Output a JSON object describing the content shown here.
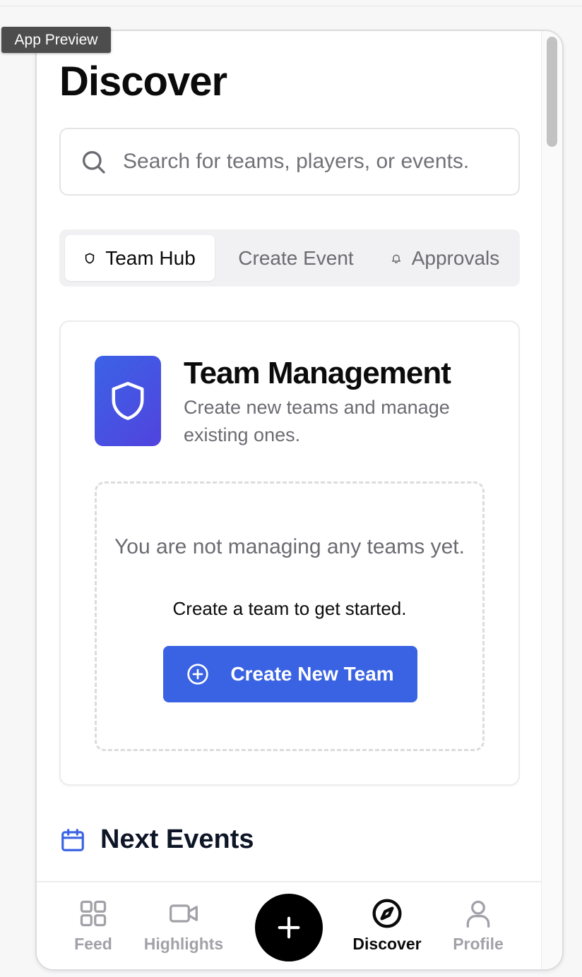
{
  "preview_tag": "App Preview",
  "page": {
    "title": "Discover"
  },
  "search": {
    "placeholder": "Search for teams, players, or events."
  },
  "tabs": [
    {
      "label": "Team Hub",
      "icon": "shield-icon",
      "active": true
    },
    {
      "label": "Create Event",
      "active": false
    },
    {
      "label": "Approvals",
      "icon": "bell-icon",
      "active": false
    }
  ],
  "team_management": {
    "title": "Team Management",
    "subtitle": "Create new teams and manage existing ones.",
    "empty_title": "You are not managing any teams yet.",
    "empty_subtitle": "Create a team to get started.",
    "create_button": "Create New Team"
  },
  "next_events": {
    "label": "Next Events"
  },
  "bottom_nav": [
    {
      "label": "Feed",
      "icon": "grid-icon",
      "active": false
    },
    {
      "label": "Highlights",
      "icon": "video-icon",
      "active": false
    },
    {
      "label": "",
      "icon": "plus-icon",
      "active": false
    },
    {
      "label": "Discover",
      "icon": "compass-icon",
      "active": true
    },
    {
      "label": "Profile",
      "icon": "user-icon",
      "active": false
    }
  ],
  "colors": {
    "accent": "#3a63e3",
    "gradient_start": "#3b63e6",
    "gradient_end": "#5143de",
    "muted_text": "#6b6b72"
  }
}
